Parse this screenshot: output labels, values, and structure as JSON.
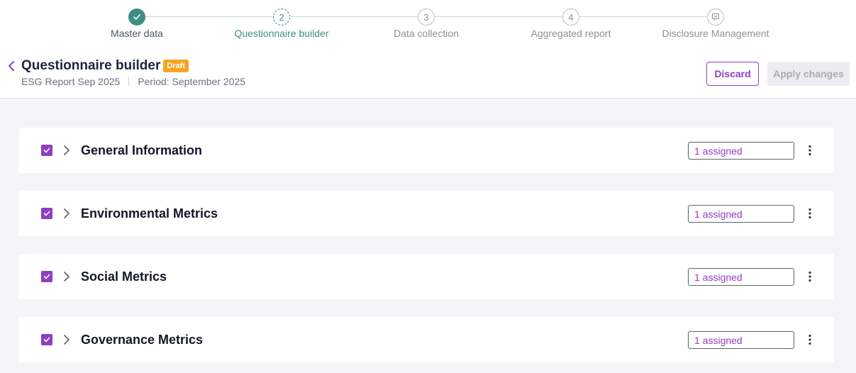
{
  "stepper": {
    "steps": [
      {
        "label": "Master data",
        "number": "",
        "state": "done"
      },
      {
        "label": "Questionnaire builder",
        "number": "2",
        "state": "current"
      },
      {
        "label": "Data collection",
        "number": "3",
        "state": "upcoming"
      },
      {
        "label": "Aggregated report",
        "number": "4",
        "state": "upcoming"
      },
      {
        "label": "Disclosure Management",
        "number": "",
        "state": "upcoming"
      }
    ]
  },
  "header": {
    "title": "Questionnaire builder",
    "badge": "Draft",
    "report_name": "ESG Report Sep 2025",
    "period": "Period: September 2025",
    "discard_label": "Discard",
    "apply_label": "Apply changes"
  },
  "sections": [
    {
      "title": "General Information",
      "assigned": "1 assigned",
      "checked": true
    },
    {
      "title": "Environmental Metrics",
      "assigned": "1 assigned",
      "checked": true
    },
    {
      "title": "Social Metrics",
      "assigned": "1 assigned",
      "checked": true
    },
    {
      "title": "Governance Metrics",
      "assigned": "1 assigned",
      "checked": true
    }
  ],
  "colors": {
    "accent": "#8e3fc2",
    "stepper_teal": "#3e8e87",
    "badge": "#f5a524"
  }
}
